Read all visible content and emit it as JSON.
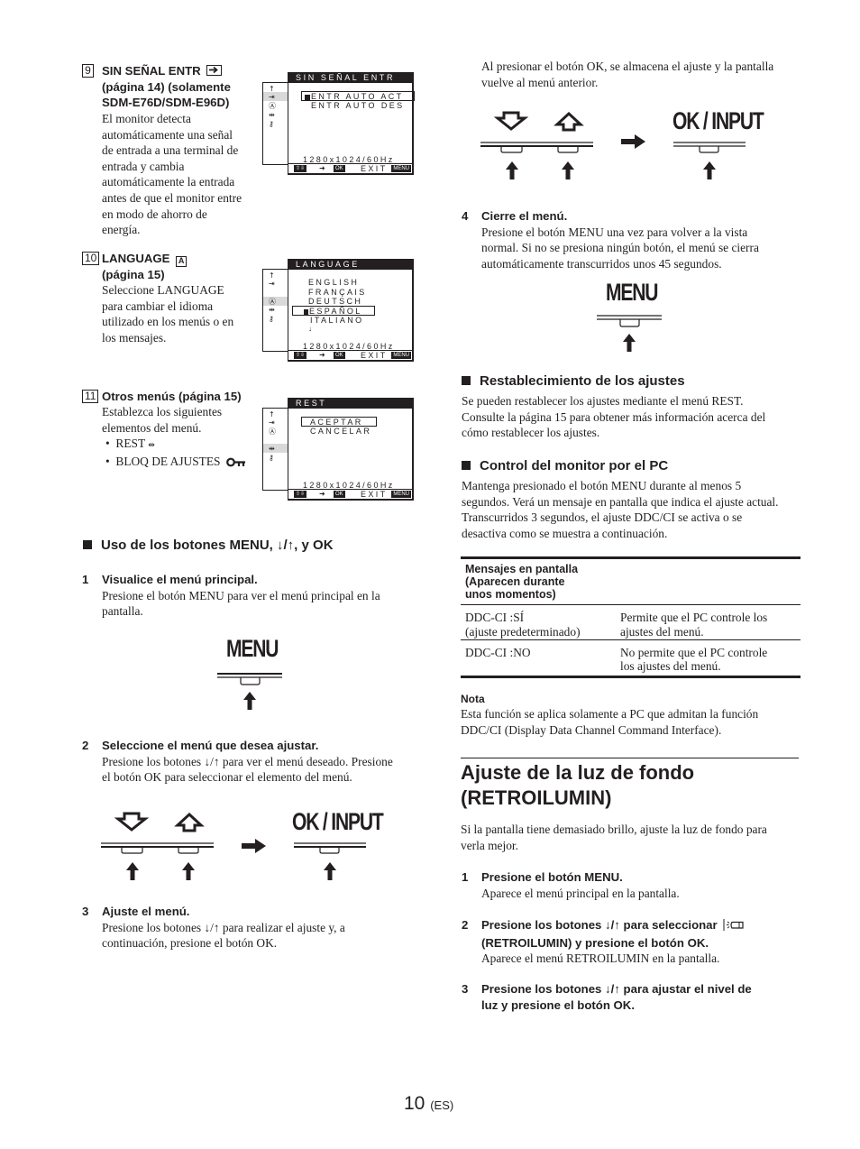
{
  "left_column": {
    "item9": {
      "number": "9",
      "title_lines": [
        "SIN SEÑAL ENTR",
        "(página 14) (solamente",
        "SDM-E76D/SDM-E96D)"
      ],
      "icon": "input-arrow-icon",
      "body_lines": [
        "El monitor detecta",
        "automáticamente una señal",
        "de entrada a una terminal de",
        "entrada y cambia",
        "automáticamente la entrada",
        "antes de que el monitor entre",
        "en modo de ahorro de",
        "energía."
      ],
      "osd": {
        "title": "SIN SEÑAL ENTR",
        "options": [
          "ENTR AUTO ACT",
          "ENTR AUTO DES"
        ],
        "selected_index": 0,
        "resolution": "1280x1024/60Hz",
        "footer_ok": "OK",
        "footer_exit": "EXIT",
        "footer_menu": "MENU"
      }
    },
    "item10": {
      "number": "10",
      "title_lines": [
        "LANGUAGE",
        "(página 15)"
      ],
      "icon": "language-icon",
      "body_lines": [
        "Seleccione LANGUAGE",
        "para cambiar el idioma",
        "utilizado en los menús o en",
        "los mensajes."
      ],
      "osd": {
        "title": "LANGUAGE",
        "options": [
          "ENGLISH",
          "FRANÇAIS",
          "DEUTSCH",
          "ESPAÑOL",
          "ITALIANO"
        ],
        "selected_index": 3,
        "more_indicator": "↓",
        "resolution": "1280x1024/60Hz",
        "footer_ok": "OK",
        "footer_exit": "EXIT",
        "footer_menu": "MENU"
      }
    },
    "item11": {
      "number": "11",
      "title": "Otros menús (página 15)",
      "body_lines": [
        "Establezca los siguientes",
        "elementos del menú."
      ],
      "bullets": [
        {
          "text": "REST",
          "icon": "reset-icon"
        },
        {
          "text": "BLOQ DE AJUSTES",
          "icon": "key-lock-icon"
        }
      ],
      "osd": {
        "title": "REST",
        "options": [
          "ACEPTAR",
          "CANCELAR"
        ],
        "selected_index": 0,
        "resolution": "1280x1024/60Hz",
        "footer_ok": "OK",
        "footer_exit": "EXIT",
        "footer_menu": "MENU"
      }
    },
    "buttons_section": {
      "heading": "Uso de los botones MENU, ↓/↑, y OK",
      "steps": [
        {
          "num": "1",
          "title": "Visualice el menú principal.",
          "body_lines": [
            "Presione el botón MENU para ver el menú principal en la",
            "pantalla."
          ],
          "diagram_label": "MENU"
        },
        {
          "num": "2",
          "title": "Seleccione el menú que desea ajustar.",
          "body_lines": [
            "Presione los botones ↓/↑ para ver el menú deseado. Presione",
            "el botón OK para seleccionar el elemento del menú."
          ],
          "diagram_label": "OK / INPUT"
        },
        {
          "num": "3",
          "title": "Ajuste el menú.",
          "body_lines": [
            "Presione los botones ↓/↑ para realizar el ajuste y, a",
            "continuación, presione el botón OK."
          ]
        }
      ]
    }
  },
  "right_column": {
    "step3_cont_lines": [
      "Al presionar el botón OK, se almacena el ajuste y la pantalla",
      "vuelve al menú anterior."
    ],
    "step3_diagram_label": "OK / INPUT",
    "step4": {
      "num": "4",
      "title": "Cierre el menú.",
      "body_lines": [
        "Presione el botón MENU una vez para volver a la vista",
        "normal. Si no se presiona ningún botón, el menú se cierra",
        "automáticamente transcurridos unos 45 segundos."
      ],
      "diagram_label": "MENU"
    },
    "reset_section": {
      "heading": "Restablecimiento de los ajustes",
      "body_lines": [
        "Se pueden restablecer los ajustes mediante el menú REST.",
        "Consulte la página 15 para obtener más información acerca del",
        "cómo restablecer los ajustes."
      ]
    },
    "pc_section": {
      "heading": "Control del monitor por el PC",
      "body_lines": [
        "Mantenga presionado el botón MENU durante al menos 5",
        "segundos. Verá un mensaje en pantalla que indica el ajuste actual.",
        "Transcurridos 3 segundos, el ajuste DDC/CI se activa o se",
        "desactiva como se muestra a continuación."
      ],
      "table": {
        "header_lines": [
          "Mensajes en pantalla",
          "(Aparecen durante",
          "unos momentos)"
        ],
        "rows": [
          {
            "message_lines": [
              "DDC-CI :SÍ",
              "(ajuste predeterminado)"
            ],
            "description_lines": [
              "Permite que el PC controle los",
              "ajustes del menú."
            ]
          },
          {
            "message_lines": [
              "DDC-CI :NO"
            ],
            "description_lines": [
              "No permite que el PC controle",
              "los ajustes del menú."
            ]
          }
        ]
      },
      "note_label": "Nota",
      "note_lines": [
        "Esta función se aplica solamente a PC que admitan la función",
        "DDC/CI (Display Data Channel Command Interface)."
      ]
    },
    "backlight_section": {
      "heading_lines": [
        "Ajuste de la luz de fondo",
        "(RETROILUMIN)"
      ],
      "intro_lines": [
        "Si la pantalla tiene demasiado brillo, ajuste la luz de fondo para",
        "verla mejor."
      ],
      "steps": [
        {
          "num": "1",
          "title_lines": [
            "Presione el botón MENU."
          ],
          "body": "Aparece el menú principal en la pantalla."
        },
        {
          "num": "2",
          "title_lines": [
            "Presione los botones ↓/↑ para seleccionar",
            "(RETROILUMIN) y presione el botón OK."
          ],
          "icon": "backlight-icon",
          "body": "Aparece el menú RETROILUMIN en la pantalla."
        },
        {
          "num": "3",
          "title_lines": [
            "Presione los botones ↓/↑ para ajustar el nivel de",
            "luz y presione el botón OK."
          ]
        }
      ]
    }
  },
  "footer": {
    "page_number": "10",
    "language": "(ES)"
  }
}
